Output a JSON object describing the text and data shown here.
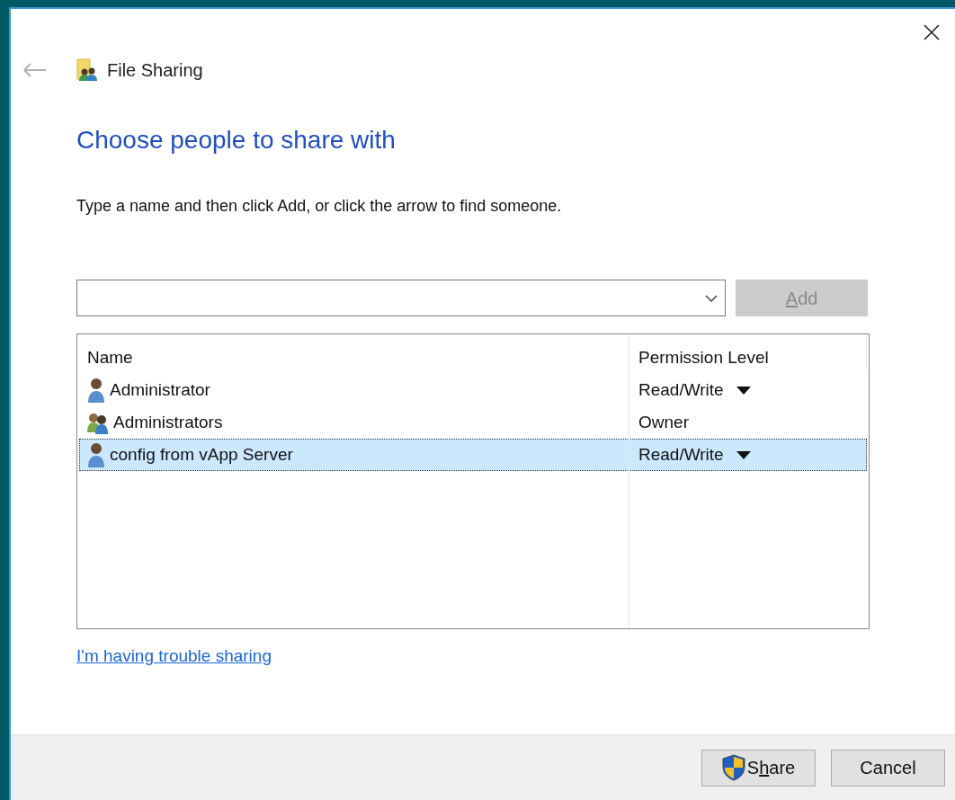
{
  "window": {
    "title": "File Sharing"
  },
  "heading": "Choose people to share with",
  "instruction": "Type a name and then click Add, or click the arrow to find someone.",
  "add_button": {
    "key": "A",
    "after": "dd",
    "disabled": true
  },
  "table": {
    "columns": [
      "Name",
      "Permission Level"
    ],
    "rows": [
      {
        "kind": "user",
        "name": "Administrator",
        "permission": "Read/Write",
        "has_dropdown": true,
        "selected": false
      },
      {
        "kind": "group",
        "name": "Administrators",
        "permission": "Owner",
        "has_dropdown": false,
        "selected": false
      },
      {
        "kind": "user",
        "name": "config from vApp Server",
        "permission": "Read/Write",
        "has_dropdown": true,
        "selected": true
      }
    ]
  },
  "help_link": "I'm having trouble sharing",
  "buttons": [
    {
      "kind": "shield",
      "before": "S",
      "key": "h",
      "after": "are"
    },
    {
      "kind": "plain",
      "before": "Cancel"
    }
  ]
}
